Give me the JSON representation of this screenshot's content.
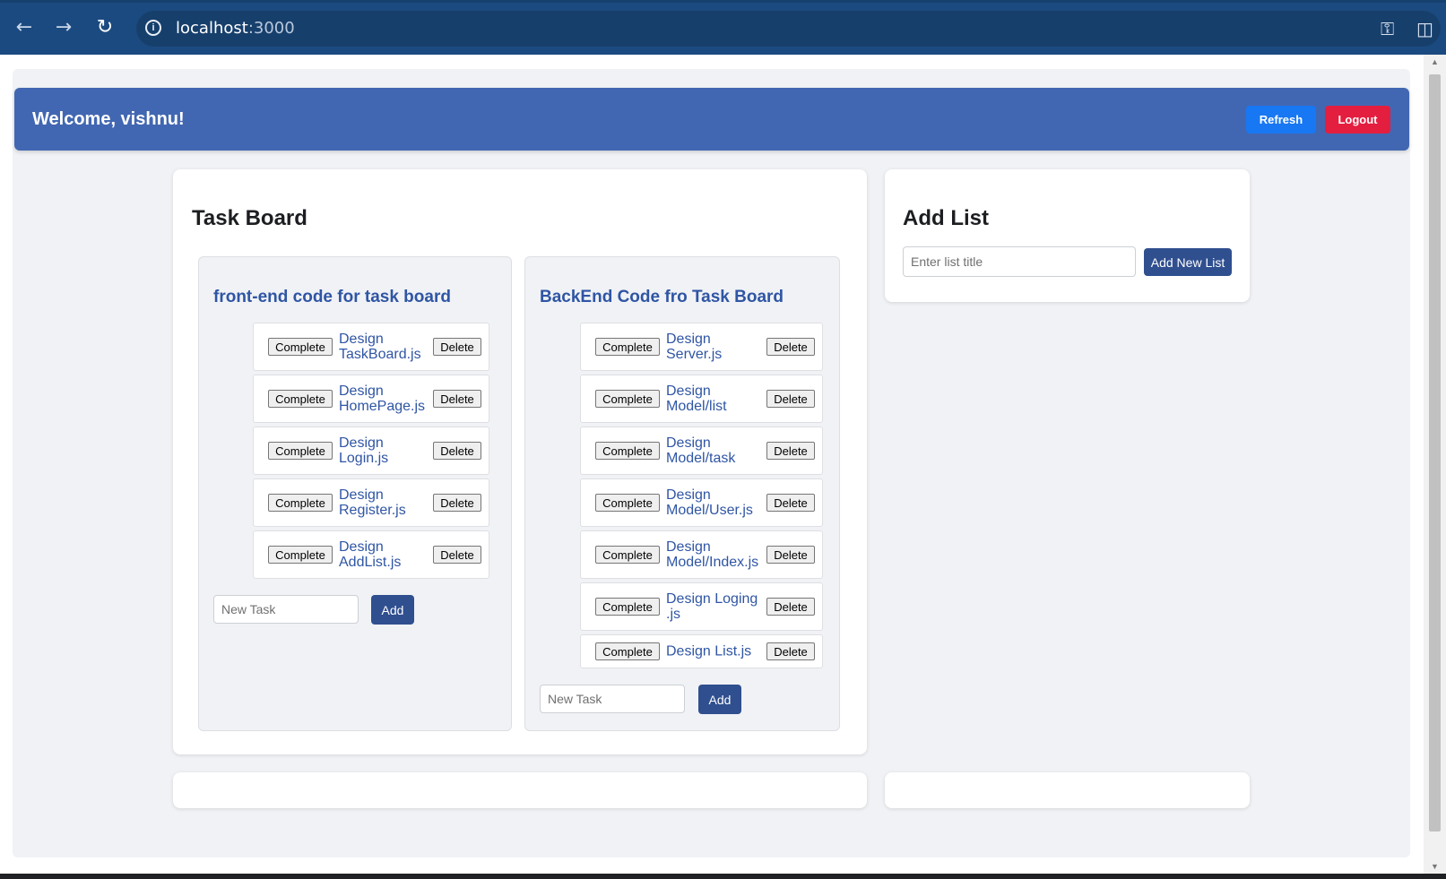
{
  "browser": {
    "url_host": "localhost",
    "url_port": ":3000",
    "back_icon": "arrow-left-icon",
    "forward_icon": "arrow-right-icon",
    "reload_icon": "reload-icon"
  },
  "header": {
    "welcome": "Welcome, vishnu!",
    "refresh_label": "Refresh",
    "logout_label": "Logout"
  },
  "task_board": {
    "title": "Task Board",
    "lists": [
      {
        "title": "front-end code for task board",
        "tasks": [
          "Design TaskBoard.js",
          "Design HomePage.js",
          "Design Login.js",
          "Design Register.js",
          "Design AddList.js"
        ],
        "new_task_placeholder": "New Task",
        "add_label": "Add"
      },
      {
        "title": "BackEnd Code fro Task Board",
        "tasks": [
          "Design Server.js",
          "Design Model/list",
          "Design Model/task",
          "Design Model/User.js",
          "Design Model/Index.js",
          "Design Loging .js",
          "Design List.js"
        ],
        "new_task_placeholder": "New Task",
        "add_label": "Add"
      }
    ],
    "complete_label": "Complete",
    "delete_label": "Delete"
  },
  "add_list": {
    "title": "Add List",
    "placeholder": "Enter list title",
    "button_label": "Add New List"
  }
}
